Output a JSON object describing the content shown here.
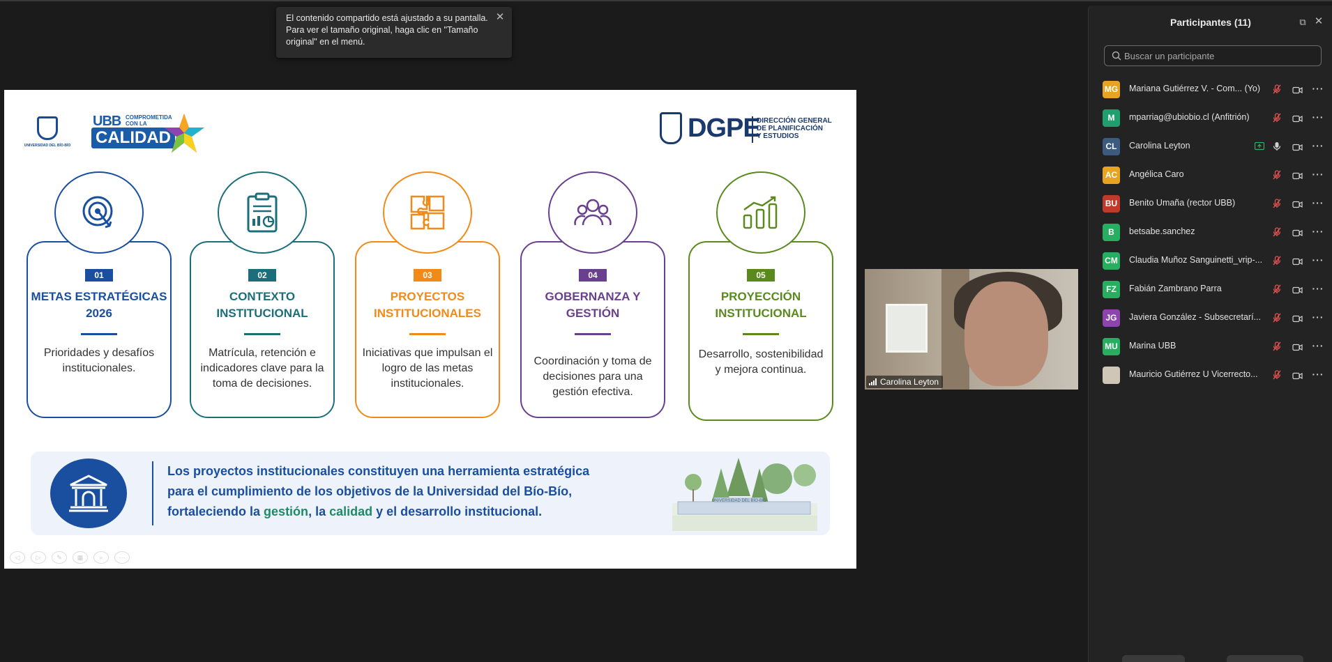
{
  "notification": {
    "text": "El contenido compartido está ajustado a su pantalla. Para ver el tamaño original, haga clic en \"Tamaño original\" en el menú.",
    "close_icon": "close-icon"
  },
  "slide": {
    "ubb_seal_text": "UNIVERSIDAD DEL BÍO-BÍO",
    "calidad_logo": {
      "ubb": "UBB",
      "comprometida": "COMPROMETIDA",
      "con_la": "CON LA",
      "calidad": "CALIDAD"
    },
    "dgpe_logo": {
      "big": "DGPE",
      "line1": "DIRECCIÓN GENERAL",
      "line2": "DE PLANIFICACIÓN",
      "line3": "Y ESTUDIOS"
    },
    "cards": [
      {
        "num": "01",
        "title": "METAS ESTRATÉGICAS 2026",
        "desc": "Prioridades y desafíos institucionales.",
        "color": "#1a4fa0",
        "icon": "target-icon"
      },
      {
        "num": "02",
        "title": "CONTEXTO INSTITUCIONAL",
        "desc": "Matrícula, retención e indicadores clave para la toma de decisiones.",
        "color": "#1b6e7a",
        "icon": "clipboard-chart-icon"
      },
      {
        "num": "03",
        "title": "PROYECTOS INSTITUCIONALES",
        "desc": "Iniciativas que impulsan el logro de las metas institucionales.",
        "color": "#f28a1a",
        "icon": "puzzle-icon"
      },
      {
        "num": "04",
        "title": "GOBERNANZA Y GESTIÓN",
        "desc": "Coordinación y toma de decisiones para una gestión efectiva.",
        "color": "#6a3f8f",
        "icon": "people-group-icon"
      },
      {
        "num": "05",
        "title": "PROYECCIÓN INSTITUCIONAL",
        "desc": "Desarrollo, sostenibilidad y mejora continua.",
        "color": "#5a8a1e",
        "icon": "growth-chart-icon"
      }
    ],
    "banner": {
      "line1": "Los proyectos institucionales constituyen una herramienta estratégica",
      "line2": "para el cumplimiento de los objetivos de la Universidad del Bío-Bío,",
      "line3_a": "fortaleciendo la ",
      "line3_gestion": "gestión",
      "line3_b": ", la ",
      "line3_calidad": "calidad",
      "line3_c": " y el desarrollo institucional.",
      "campus_sign": "UNIVERSIDAD DEL BÍO-BÍO",
      "icon": "university-building-icon"
    }
  },
  "video": {
    "name": "Carolina Leyton"
  },
  "panel": {
    "title": "Participantes (11)",
    "search_placeholder": "Buscar un participante",
    "participants": [
      {
        "initials": "MG",
        "name": "Mariana Gutiérrez V. - Com... (Yo)",
        "color": "#e8a320",
        "mic": "muted",
        "share": false
      },
      {
        "initials": "M",
        "name": "mparriag@ubiobio.cl (Anfitrión)",
        "color": "#1f9e6e",
        "mic": "muted",
        "share": false
      },
      {
        "initials": "CL",
        "name": "Carolina Leyton",
        "color": "#3d5a80",
        "mic": "on",
        "share": true
      },
      {
        "initials": "AC",
        "name": "Angélica Caro",
        "color": "#e8a320",
        "mic": "muted",
        "share": false
      },
      {
        "initials": "BU",
        "name": "Benito Umaña (rector UBB)",
        "color": "#c0392b",
        "mic": "muted",
        "share": false
      },
      {
        "initials": "B",
        "name": "betsabe.sanchez",
        "color": "#27ae60",
        "mic": "muted",
        "share": false
      },
      {
        "initials": "CM",
        "name": "Claudia Muñoz Sanguinetti_vrip-...",
        "color": "#27ae60",
        "mic": "muted",
        "share": false
      },
      {
        "initials": "FZ",
        "name": "Fabián Zambrano Parra",
        "color": "#27ae60",
        "mic": "muted",
        "share": false
      },
      {
        "initials": "JG",
        "name": "Javiera González - Subsecretarí...",
        "color": "#8e44ad",
        "mic": "muted",
        "share": false
      },
      {
        "initials": "MU",
        "name": "Marina UBB",
        "color": "#27ae60",
        "mic": "muted",
        "share": false
      },
      {
        "initials": "",
        "name": "Mauricio Gutiérrez U Vicerrecto...",
        "color": "#cfc6b8",
        "mic": "muted",
        "share": false
      }
    ]
  }
}
